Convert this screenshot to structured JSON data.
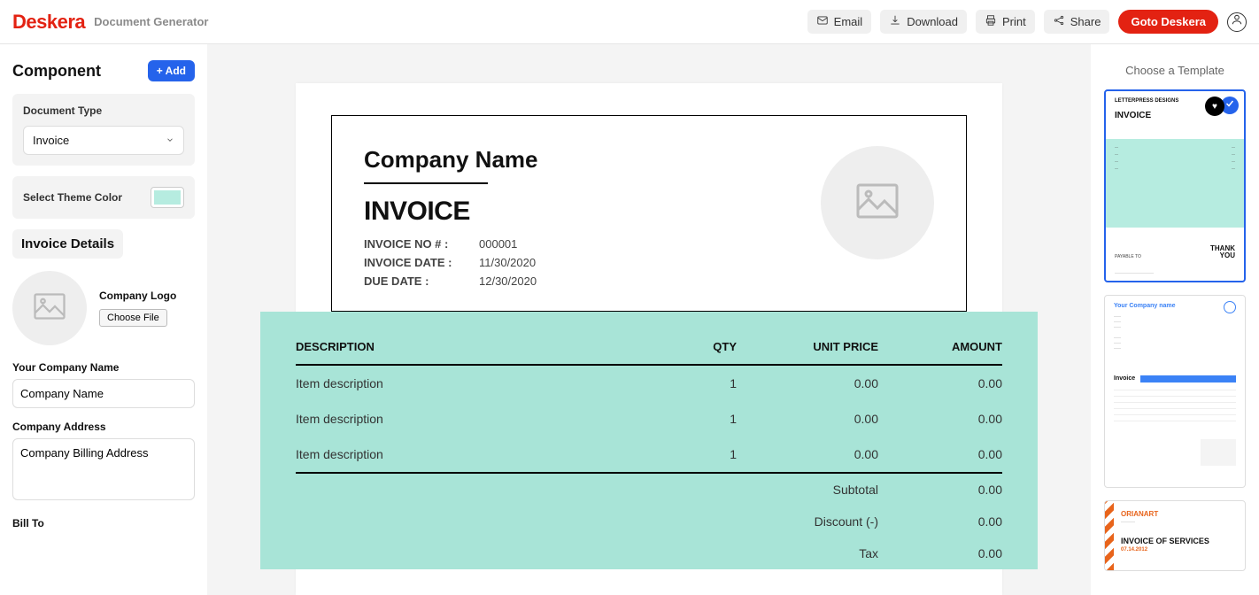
{
  "header": {
    "brand": "Deskera",
    "subtitle": "Document Generator",
    "email": "Email",
    "download": "Download",
    "print": "Print",
    "share": "Share",
    "goto": "Goto Deskera"
  },
  "left": {
    "component": "Component",
    "add": "+ Add",
    "docTypeLabel": "Document Type",
    "docTypeValue": "Invoice",
    "themeLabel": "Select Theme Color",
    "themeColor": "#b6ece0",
    "invoiceDetails": "Invoice Details",
    "companyLogo": "Company Logo",
    "chooseFile": "Choose File",
    "yourCompanyNameLabel": "Your Company Name",
    "yourCompanyNameValue": "Company Name",
    "companyAddressLabel": "Company Address",
    "companyAddressValue": "Company Billing Address",
    "billToLabel": "Bill To"
  },
  "invoice": {
    "companyName": "Company Name",
    "title": "INVOICE",
    "noLabel": "INVOICE NO # :",
    "noValue": "000001",
    "dateLabel": "INVOICE DATE :",
    "dateValue": "11/30/2020",
    "dueLabel": "DUE DATE :",
    "dueValue": "12/30/2020",
    "cols": {
      "desc": "DESCRIPTION",
      "qty": "QTY",
      "price": "UNIT PRICE",
      "amount": "AMOUNT"
    },
    "items": [
      {
        "desc": "Item description",
        "qty": "1",
        "price": "0.00",
        "amount": "0.00"
      },
      {
        "desc": "Item description",
        "qty": "1",
        "price": "0.00",
        "amount": "0.00"
      },
      {
        "desc": "Item description",
        "qty": "1",
        "price": "0.00",
        "amount": "0.00"
      }
    ],
    "subtotalLabel": "Subtotal",
    "subtotalValue": "0.00",
    "discountLabel": "Discount (-)",
    "discountValue": "0.00",
    "taxLabel": "Tax",
    "taxValue": "0.00"
  },
  "right": {
    "choose": "Choose a Template",
    "t1": {
      "letterpress": "LETTERPRESS DESIGNS",
      "invoice": "INVOICE",
      "thank": "THANK",
      "you": "YOU",
      "payable": "PAYABLE TO"
    },
    "t2": {
      "company": "Your Company name",
      "invoice": "Invoice"
    },
    "t3": {
      "brand": "ORIANART",
      "title": "INVOICE OF SERVICES",
      "date": "07.14.2012"
    }
  }
}
